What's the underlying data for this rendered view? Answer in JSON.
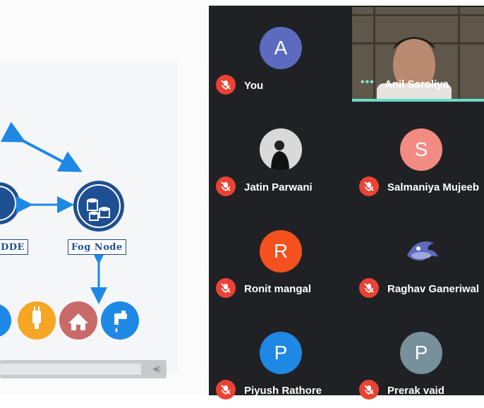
{
  "slide": {
    "node_left_label": "DDE",
    "node_right_label": "Fog Node"
  },
  "participants": [
    {
      "name": "You",
      "initial": "A",
      "color": "#5c6bc0",
      "muted": true,
      "type": "initial"
    },
    {
      "name": "Anil Saroliya",
      "muted": false,
      "type": "video"
    },
    {
      "name": "Jatin Parwani",
      "muted": true,
      "type": "photo"
    },
    {
      "name": "Salmaniya Mujeeb",
      "initial": "S",
      "color": "#f28b82",
      "muted": true,
      "type": "initial"
    },
    {
      "name": "Ronit mangal",
      "initial": "R",
      "color": "#f4511e",
      "muted": true,
      "type": "initial"
    },
    {
      "name": "Raghav Ganeriwal",
      "muted": true,
      "type": "logo"
    },
    {
      "name": "Piyush Rathore",
      "initial": "P",
      "color": "#1e88e5",
      "muted": true,
      "type": "initial"
    },
    {
      "name": "Prerak vaid",
      "initial": "P",
      "color": "#78909c",
      "muted": true,
      "type": "initial"
    }
  ],
  "colors": {
    "grid_bg": "#202124",
    "mute_red": "#ea4335",
    "accent_teal": "#6bdbc8",
    "node_blue": "#1f4f93"
  }
}
